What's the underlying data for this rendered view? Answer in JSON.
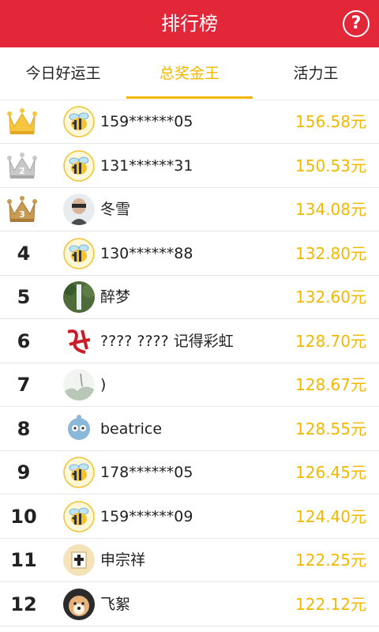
{
  "header": {
    "title": "排行榜",
    "help_icon": "question-icon",
    "help_label": "?",
    "bg_color": "#e22838"
  },
  "tabs": [
    {
      "label": "今日好运王",
      "active": false
    },
    {
      "label": "总奖金王",
      "active": true
    },
    {
      "label": "活力王",
      "active": false
    }
  ],
  "accent_color": "#f2b800",
  "rows": [
    {
      "rank": "1",
      "crown": "gold",
      "avatar": "bee-avatar",
      "name": "159******05",
      "amount": "156.58元"
    },
    {
      "rank": "2",
      "crown": "silver",
      "avatar": "bee-avatar",
      "name": "131******31",
      "amount": "150.53元"
    },
    {
      "rank": "3",
      "crown": "bronze",
      "avatar": "photo-avatar",
      "name": "冬雪",
      "amount": "134.08元"
    },
    {
      "rank": "4",
      "avatar": "bee-avatar",
      "name": "130******88",
      "amount": "132.80元"
    },
    {
      "rank": "5",
      "avatar": "waterfall-avatar",
      "name": "醉梦",
      "amount": "132.60元"
    },
    {
      "rank": "6",
      "avatar": "calligraphy-avatar",
      "name": "???? ???? 记得彩虹",
      "amount": "128.70元"
    },
    {
      "rank": "7",
      "avatar": "landscape-avatar",
      "name": ")",
      "amount": "128.67元"
    },
    {
      "rank": "8",
      "avatar": "cartoon-avatar",
      "name": "beatrice",
      "amount": "128.55元"
    },
    {
      "rank": "9",
      "avatar": "bee-avatar",
      "name": "178******05",
      "amount": "126.45元"
    },
    {
      "rank": "10",
      "avatar": "bee-avatar",
      "name": "159******09",
      "amount": "124.40元"
    },
    {
      "rank": "11",
      "avatar": "seal-avatar",
      "name": "申宗祥",
      "amount": "122.25元"
    },
    {
      "rank": "12",
      "avatar": "dog-avatar",
      "name": "飞絮",
      "amount": "122.12元"
    }
  ]
}
